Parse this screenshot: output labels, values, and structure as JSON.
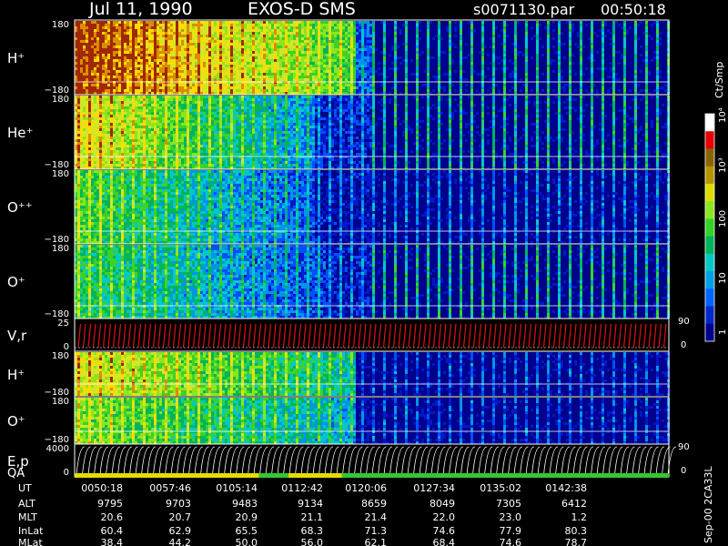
{
  "header": {
    "date": "Jul 11, 1990",
    "mission": "EXOS-D SMS",
    "file": "s0071130.par",
    "time": "00:50:18"
  },
  "colorbar": {
    "unit_label": "Ct/Smp",
    "ticks": [
      "1",
      "10",
      "100",
      "10³",
      "10⁴"
    ]
  },
  "side_label": "Sep-00 2CA33L",
  "chart_data": {
    "type": "heatmap",
    "panels": [
      {
        "id": "h-plus",
        "label": "H⁺",
        "ymax": "180",
        "ymin": "−180"
      },
      {
        "id": "he-plus",
        "label": "He⁺",
        "ymax": "180",
        "ymin": "−180"
      },
      {
        "id": "o-plus-plus",
        "label": "O⁺⁺",
        "ymax": "180",
        "ymin": "−180"
      },
      {
        "id": "o-plus",
        "label": "O⁺",
        "ymax": "180",
        "ymin": "−180"
      },
      {
        "id": "v-r",
        "label": "V,r",
        "ymax": "25",
        "ymin": "0",
        "right_max": "90",
        "right_min": "0"
      },
      {
        "id": "h-plus-2",
        "label": "H⁺",
        "ymax": "180",
        "ymin": "−180"
      },
      {
        "id": "o-plus-2",
        "label": "O⁺",
        "ymax": "180",
        "ymin": "−180"
      },
      {
        "id": "e-p",
        "label": "E,p",
        "ymax": "4000",
        "ymin": "0",
        "right_max": "90",
        "right_min": "0"
      }
    ],
    "qa_label": "QA",
    "ephemeris": {
      "labels": [
        "UT",
        "ALT",
        "MLT",
        "InLat",
        "MLat"
      ],
      "columns": [
        [
          "0050:18",
          "9795",
          "20.6",
          "60.4",
          "38.4"
        ],
        [
          "0057:46",
          "9703",
          "20.7",
          "62.9",
          "44.2"
        ],
        [
          "0105:14",
          "9483",
          "20.9",
          "65.5",
          "50.0"
        ],
        [
          "0112:42",
          "9134",
          "21.1",
          "68.3",
          "56.0"
        ],
        [
          "0120:06",
          "8659",
          "21.4",
          "71.3",
          "62.1"
        ],
        [
          "0127:34",
          "8049",
          "22.0",
          "74.6",
          "68.4"
        ],
        [
          "0135:02",
          "7305",
          "23.0",
          "77.9",
          "74.6"
        ],
        [
          "0142:38",
          "6412",
          "1.2",
          "80.3",
          "78.7"
        ]
      ]
    }
  }
}
